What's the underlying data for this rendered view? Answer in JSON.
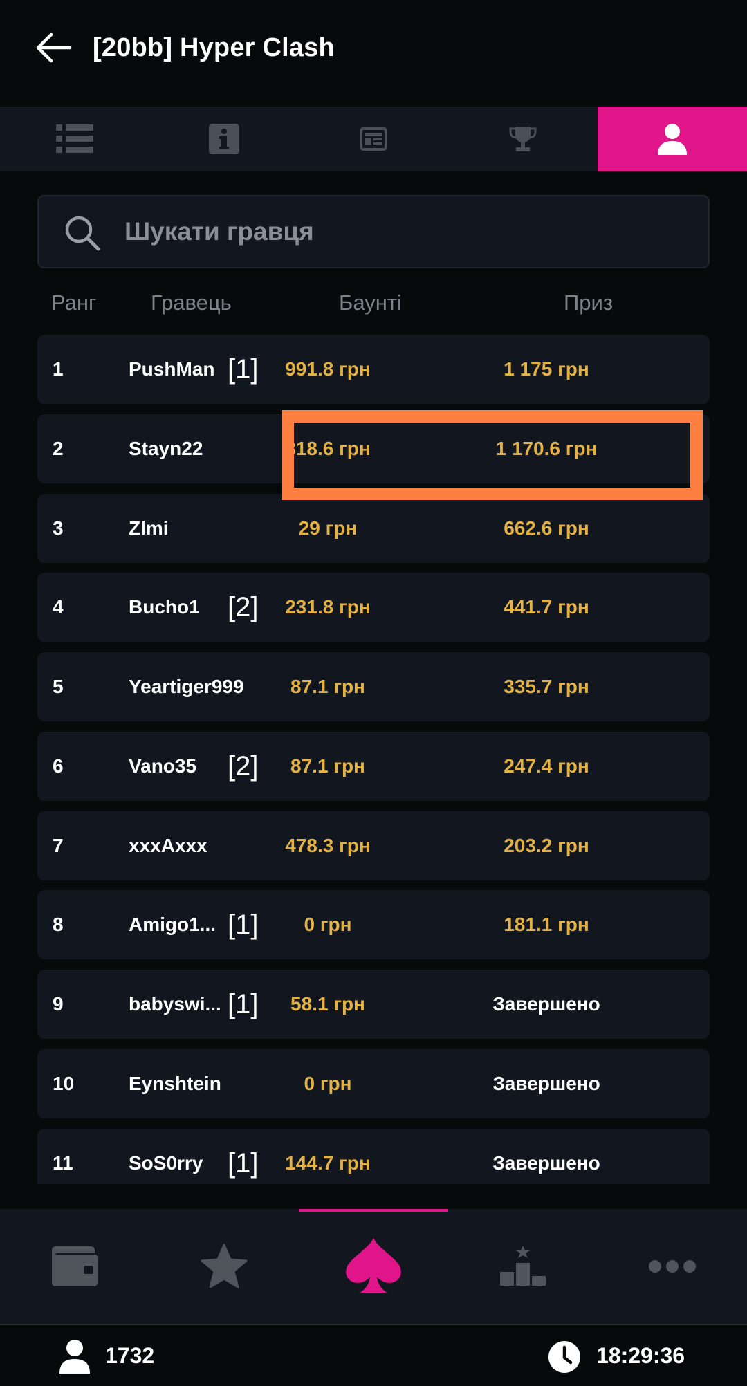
{
  "header": {
    "title": "[20bb] Hyper Clash"
  },
  "tabs": [
    {
      "icon": "list-icon",
      "active": false
    },
    {
      "icon": "info-icon",
      "active": false
    },
    {
      "icon": "structure-icon",
      "active": false
    },
    {
      "icon": "trophy-icon",
      "active": false
    },
    {
      "icon": "player-icon",
      "active": true
    }
  ],
  "search": {
    "placeholder": "Шукати гравця",
    "value": ""
  },
  "columns": {
    "rank": "Ранг",
    "player": "Гравець",
    "bounty": "Баунті",
    "prize": "Приз"
  },
  "rows": [
    {
      "rank": "1",
      "player": "PushMan",
      "reentry": "[1]",
      "bounty": "991.8 грн",
      "prize": "1 175 грн"
    },
    {
      "rank": "2",
      "player": "Stayn22",
      "reentry": "",
      "bounty": "818.6 грн",
      "prize": "1 170.6 грн"
    },
    {
      "rank": "3",
      "player": "Zlmi",
      "reentry": "",
      "bounty": "29 грн",
      "prize": "662.6 грн"
    },
    {
      "rank": "4",
      "player": "Bucho1",
      "reentry": "[2]",
      "bounty": "231.8 грн",
      "prize": "441.7 грн"
    },
    {
      "rank": "5",
      "player": "Yeartiger999",
      "reentry": "",
      "bounty": "87.1 грн",
      "prize": "335.7 грн"
    },
    {
      "rank": "6",
      "player": "Vano35",
      "reentry": "[2]",
      "bounty": "87.1 грн",
      "prize": "247.4 грн"
    },
    {
      "rank": "7",
      "player": "xxxAxxx",
      "reentry": "",
      "bounty": "478.3 грн",
      "prize": "203.2 грн"
    },
    {
      "rank": "8",
      "player": "Amigo1...",
      "reentry": "[1]",
      "bounty": "0 грн",
      "prize": "181.1 грн"
    },
    {
      "rank": "9",
      "player": "babyswi...",
      "reentry": "[1]",
      "bounty": "58.1 грн",
      "prize": "Завершено"
    },
    {
      "rank": "10",
      "player": "Eynshtein",
      "reentry": "",
      "bounty": "0 грн",
      "prize": "Завершено"
    },
    {
      "rank": "11",
      "player": "SoS0rry",
      "reentry": "[1]",
      "bounty": "144.7 грн",
      "prize": "Завершено"
    }
  ],
  "bottom_nav": [
    {
      "icon": "wallet-icon",
      "active": false
    },
    {
      "icon": "star-icon",
      "active": false
    },
    {
      "icon": "spade-icon",
      "active": true
    },
    {
      "icon": "leaderboard-icon",
      "active": false
    },
    {
      "icon": "more-icon",
      "active": false
    }
  ],
  "status": {
    "players_count": "1732",
    "time": "18:29:36"
  },
  "colors": {
    "accent": "#e0158a",
    "money": "#e3b243",
    "highlight": "#ff7f41",
    "row_bg": "#11161f"
  }
}
